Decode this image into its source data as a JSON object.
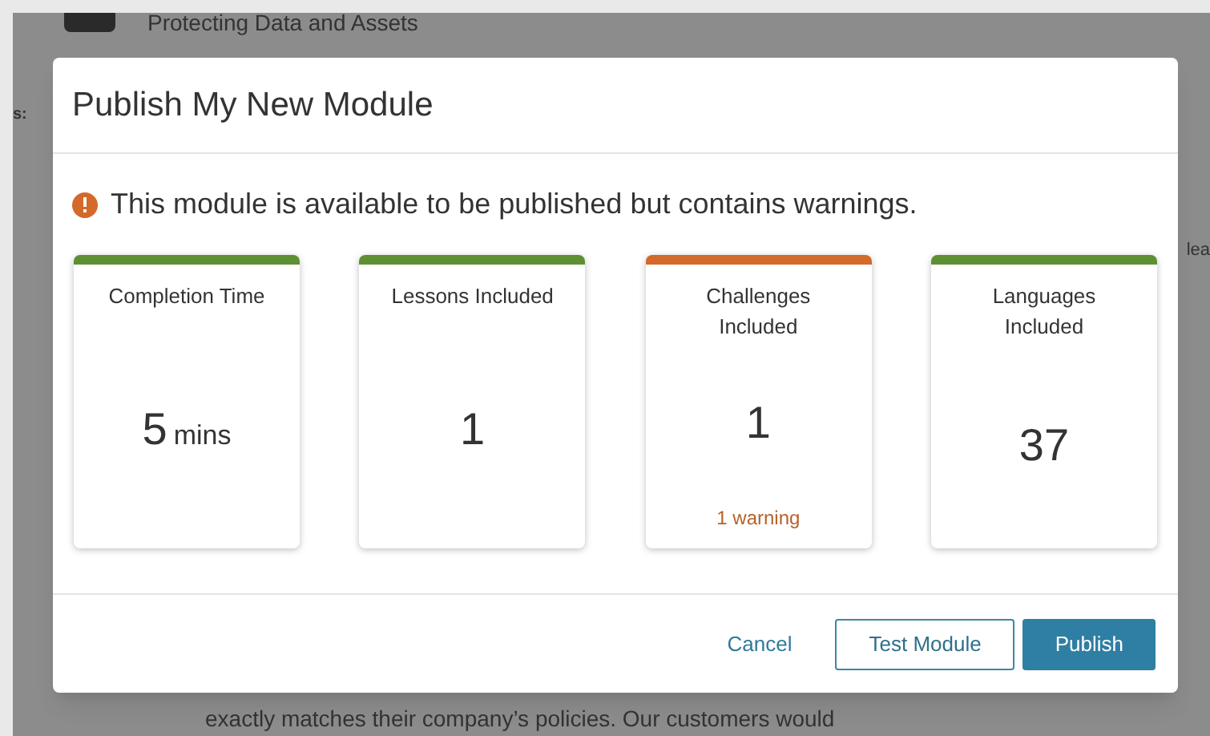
{
  "background": {
    "subtitle": "Protecting Data and Assets",
    "side_label": "s:",
    "right_fragment": "lea",
    "body_text": "exactly matches their company’s policies. Our customers would"
  },
  "dialog": {
    "title": "Publish My New Module",
    "message": "This module is available to be published but contains warnings.",
    "cards": [
      {
        "label": "Completion Time",
        "value": "5",
        "unit": "mins",
        "color": "#5e8f33"
      },
      {
        "label": "Lessons Included",
        "value": "1",
        "color": "#5e8f33"
      },
      {
        "label": "Challenges Included",
        "value": "1",
        "color": "#d3692b",
        "note": "1 warning"
      },
      {
        "label": "Languages Included",
        "value": "37",
        "color": "#5e8f33"
      }
    ],
    "buttons": [
      {
        "label": "Cancel",
        "kind": "link"
      },
      {
        "label": "Test Module",
        "kind": "outline"
      },
      {
        "label": "Publish",
        "kind": "primary"
      }
    ]
  }
}
